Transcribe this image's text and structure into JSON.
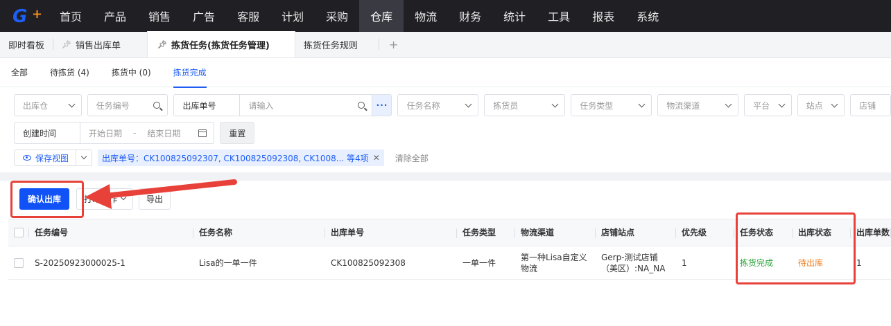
{
  "nav": {
    "items": [
      "首页",
      "产品",
      "销售",
      "广告",
      "客服",
      "计划",
      "采购",
      "仓库",
      "物流",
      "财务",
      "统计",
      "工具",
      "报表",
      "系统"
    ],
    "active": "仓库"
  },
  "tabs": [
    {
      "label": "即时看板",
      "pinned": false
    },
    {
      "label": "销售出库单",
      "pinned": true
    },
    {
      "label": "拣货任务(拣货任务管理)",
      "pinned": true,
      "active": true
    },
    {
      "label": "拣货任务规则",
      "pinned": false
    }
  ],
  "tab_add": "+",
  "subtabs": [
    {
      "label": "全部"
    },
    {
      "label": "待拣货 (4)"
    },
    {
      "label": "拣货中 (0)"
    },
    {
      "label": "拣货完成",
      "active": true
    }
  ],
  "filters": {
    "warehouse": "出库仓",
    "task_no": "任务编号",
    "out_order_label": "出库单号",
    "out_order_placeholder": "请输入",
    "more": "···",
    "task_name": "任务名称",
    "picker": "拣货员",
    "task_type": "任务类型",
    "logistics": "物流渠道",
    "platform": "平台",
    "site": "站点",
    "store": "店铺",
    "created_label": "创建时间",
    "start_date": "开始日期",
    "dash": "-",
    "end_date": "结束日期",
    "reset": "重置",
    "save_view": "保存视图",
    "active_tag": "出库单号：CK100825092307, CK100825092308, CK1008... 等4项",
    "clear_all": "清除全部"
  },
  "toolbar": {
    "confirm": "确认出库",
    "print": "打印操作",
    "export": "导出"
  },
  "table": {
    "headers": [
      "任务编号",
      "任务名称",
      "出库单号",
      "任务类型",
      "物流渠道",
      "店铺站点",
      "优先级",
      "任务状态",
      "出库状态",
      "出库单数"
    ],
    "rows": [
      {
        "task_no": "S-20250923000025-1",
        "task_name": "Lisa的一单一件",
        "out_order": "CK100825092308",
        "task_type": "一单一件",
        "logistics": "第一种Lisa自定义物流",
        "store_site": "Gerp-测试店铺（美区）:NA_NA",
        "priority": "1",
        "task_status": "拣货完成",
        "out_status": "待出库",
        "out_count": "1"
      }
    ]
  },
  "colors": {
    "primary": "#1052f6",
    "nav_bg": "#1f1f24",
    "annotation_red": "#e8413a",
    "status_green": "#2aa53a",
    "status_orange": "#f07b1a"
  }
}
